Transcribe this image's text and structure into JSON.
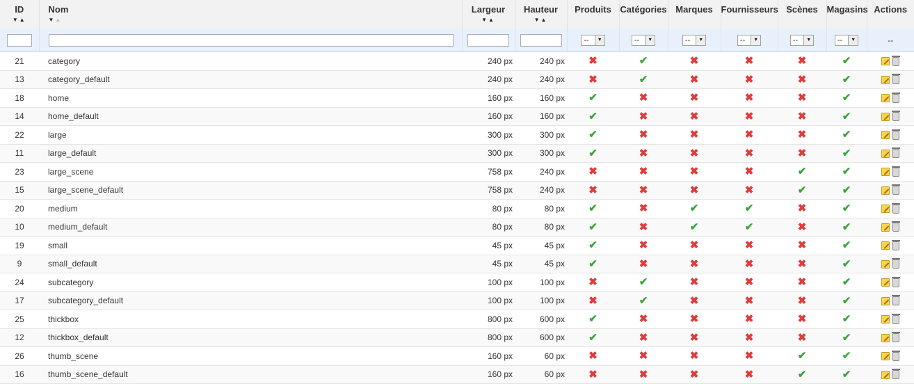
{
  "columns": {
    "id": "ID",
    "name": "Nom",
    "width": "Largeur",
    "height": "Hauteur",
    "products": "Produits",
    "categories": "Catégories",
    "manufacturers": "Marques",
    "suppliers": "Fournisseurs",
    "scenes": "Scènes",
    "stores": "Magasins",
    "actions": "Actions"
  },
  "sort_icons": {
    "desc": "▼",
    "asc": "▲"
  },
  "filters": {
    "id_value": "",
    "name_value": "",
    "width_value": "",
    "height_value": "",
    "select_value": "--",
    "select_arrow": "▼",
    "actions_placeholder": "--"
  },
  "icons": {
    "yes": "✔",
    "no": "✖"
  },
  "rows": [
    {
      "id": "21",
      "name": "category",
      "width": "240 px",
      "height": "240 px",
      "products": "no",
      "categories": "yes",
      "manufacturers": "no",
      "suppliers": "no",
      "scenes": "no",
      "stores": "yes"
    },
    {
      "id": "13",
      "name": "category_default",
      "width": "240 px",
      "height": "240 px",
      "products": "no",
      "categories": "yes",
      "manufacturers": "no",
      "suppliers": "no",
      "scenes": "no",
      "stores": "yes"
    },
    {
      "id": "18",
      "name": "home",
      "width": "160 px",
      "height": "160 px",
      "products": "yes",
      "categories": "no",
      "manufacturers": "no",
      "suppliers": "no",
      "scenes": "no",
      "stores": "yes"
    },
    {
      "id": "14",
      "name": "home_default",
      "width": "160 px",
      "height": "160 px",
      "products": "yes",
      "categories": "no",
      "manufacturers": "no",
      "suppliers": "no",
      "scenes": "no",
      "stores": "yes"
    },
    {
      "id": "22",
      "name": "large",
      "width": "300 px",
      "height": "300 px",
      "products": "yes",
      "categories": "no",
      "manufacturers": "no",
      "suppliers": "no",
      "scenes": "no",
      "stores": "yes"
    },
    {
      "id": "11",
      "name": "large_default",
      "width": "300 px",
      "height": "300 px",
      "products": "yes",
      "categories": "no",
      "manufacturers": "no",
      "suppliers": "no",
      "scenes": "no",
      "stores": "yes"
    },
    {
      "id": "23",
      "name": "large_scene",
      "width": "758 px",
      "height": "240 px",
      "products": "no",
      "categories": "no",
      "manufacturers": "no",
      "suppliers": "no",
      "scenes": "yes",
      "stores": "yes"
    },
    {
      "id": "15",
      "name": "large_scene_default",
      "width": "758 px",
      "height": "240 px",
      "products": "no",
      "categories": "no",
      "manufacturers": "no",
      "suppliers": "no",
      "scenes": "yes",
      "stores": "yes"
    },
    {
      "id": "20",
      "name": "medium",
      "width": "80 px",
      "height": "80 px",
      "products": "yes",
      "categories": "no",
      "manufacturers": "yes",
      "suppliers": "yes",
      "scenes": "no",
      "stores": "yes"
    },
    {
      "id": "10",
      "name": "medium_default",
      "width": "80 px",
      "height": "80 px",
      "products": "yes",
      "categories": "no",
      "manufacturers": "yes",
      "suppliers": "yes",
      "scenes": "no",
      "stores": "yes"
    },
    {
      "id": "19",
      "name": "small",
      "width": "45 px",
      "height": "45 px",
      "products": "yes",
      "categories": "no",
      "manufacturers": "no",
      "suppliers": "no",
      "scenes": "no",
      "stores": "yes"
    },
    {
      "id": "9",
      "name": "small_default",
      "width": "45 px",
      "height": "45 px",
      "products": "yes",
      "categories": "no",
      "manufacturers": "no",
      "suppliers": "no",
      "scenes": "no",
      "stores": "yes"
    },
    {
      "id": "24",
      "name": "subcategory",
      "width": "100 px",
      "height": "100 px",
      "products": "no",
      "categories": "yes",
      "manufacturers": "no",
      "suppliers": "no",
      "scenes": "no",
      "stores": "yes"
    },
    {
      "id": "17",
      "name": "subcategory_default",
      "width": "100 px",
      "height": "100 px",
      "products": "no",
      "categories": "yes",
      "manufacturers": "no",
      "suppliers": "no",
      "scenes": "no",
      "stores": "yes"
    },
    {
      "id": "25",
      "name": "thickbox",
      "width": "800 px",
      "height": "600 px",
      "products": "yes",
      "categories": "no",
      "manufacturers": "no",
      "suppliers": "no",
      "scenes": "no",
      "stores": "yes"
    },
    {
      "id": "12",
      "name": "thickbox_default",
      "width": "800 px",
      "height": "600 px",
      "products": "yes",
      "categories": "no",
      "manufacturers": "no",
      "suppliers": "no",
      "scenes": "no",
      "stores": "yes"
    },
    {
      "id": "26",
      "name": "thumb_scene",
      "width": "160 px",
      "height": "60 px",
      "products": "no",
      "categories": "no",
      "manufacturers": "no",
      "suppliers": "no",
      "scenes": "yes",
      "stores": "yes"
    },
    {
      "id": "16",
      "name": "thumb_scene_default",
      "width": "160 px",
      "height": "60 px",
      "products": "no",
      "categories": "no",
      "manufacturers": "no",
      "suppliers": "no",
      "scenes": "yes",
      "stores": "yes"
    }
  ],
  "colors": {
    "yes": "#3aa53a",
    "no": "#e03b3b",
    "filter_bg": "#e8f1fb",
    "header_bg": "#f2f2f2"
  },
  "icon_names": {
    "edit": "edit-pencil-icon",
    "delete": "trash-can-icon"
  }
}
